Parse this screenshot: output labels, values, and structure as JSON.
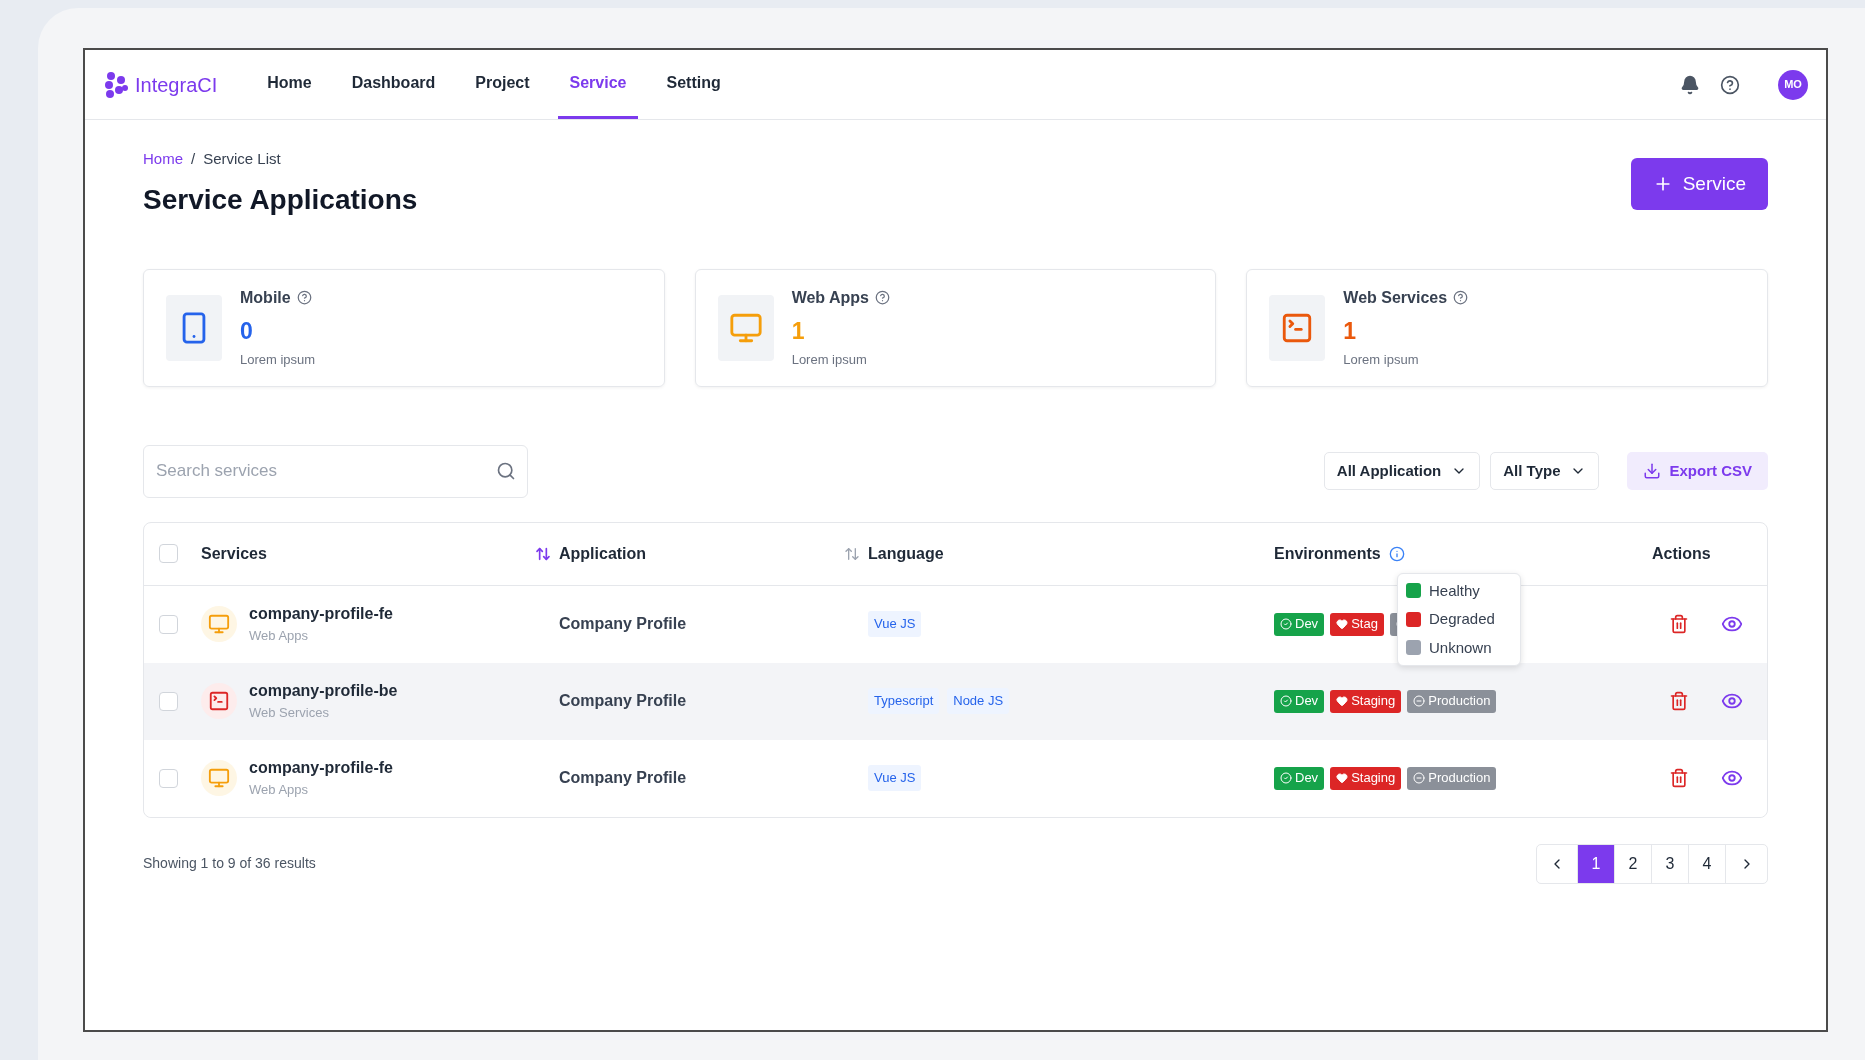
{
  "brand": {
    "name": "IntegraCI"
  },
  "nav": [
    {
      "label": "Home",
      "selected": false
    },
    {
      "label": "Dashboard",
      "selected": false
    },
    {
      "label": "Project",
      "selected": false
    },
    {
      "label": "Service",
      "selected": true
    },
    {
      "label": "Setting",
      "selected": false
    }
  ],
  "user": {
    "initials": "MO"
  },
  "breadcrumb": [
    {
      "label": "Home",
      "link": true
    },
    {
      "label": "Service List",
      "link": false
    }
  ],
  "breadcrumb_separator": "/",
  "page_title": "Service Applications",
  "add_button": {
    "label": "Service"
  },
  "cards": [
    {
      "kind": "mobile",
      "title": "Mobile",
      "value": "0",
      "caption": "Lorem ipsum"
    },
    {
      "kind": "web_app",
      "title": "Web Apps",
      "value": "1",
      "caption": "Lorem ipsum"
    },
    {
      "kind": "web_service",
      "title": "Web Services",
      "value": "1",
      "caption": "Lorem ipsum"
    }
  ],
  "search": {
    "placeholder": "Search services"
  },
  "filters": [
    {
      "label": "All Application"
    },
    {
      "label": "All Type"
    }
  ],
  "export_button": {
    "label": "Export CSV"
  },
  "table": {
    "select_all": {
      "checked": false
    },
    "columns": [
      {
        "label": "Services",
        "sortable": true,
        "sort_active": true
      },
      {
        "label": "Application",
        "sortable": true,
        "sort_active": false
      },
      {
        "label": "Language"
      },
      {
        "label": "Environments",
        "info": true
      },
      {
        "label": "Actions"
      }
    ],
    "legend": [
      {
        "label": "Healthy",
        "color": "#16a34a"
      },
      {
        "label": "Degraded",
        "color": "#dc2626"
      },
      {
        "label": "Unknown",
        "color": "#9ca3af"
      }
    ],
    "rows": [
      {
        "checked": false,
        "hovered": false,
        "kind": "web_app",
        "name": "company-profile-fe",
        "type": "Web Apps",
        "application": "Company Profile",
        "languages": [
          "Vue JS"
        ],
        "environments": [
          {
            "kind": "healthy",
            "label": "Dev"
          },
          {
            "kind": "degraded",
            "label": "Stag"
          },
          {
            "kind": "unknown"
          }
        ]
      },
      {
        "checked": false,
        "hovered": true,
        "kind": "web_service",
        "name": "company-profile-be",
        "type": "Web Services",
        "application": "Company Profile",
        "languages": [
          "Typescript",
          "Node JS"
        ],
        "environments": [
          {
            "kind": "healthy",
            "label": "Dev"
          },
          {
            "kind": "degraded",
            "label": "Staging"
          },
          {
            "kind": "unknown",
            "label": "Production"
          }
        ]
      },
      {
        "checked": false,
        "hovered": false,
        "kind": "web_app",
        "name": "company-profile-fe",
        "type": "Web Apps",
        "application": "Company Profile",
        "languages": [
          "Vue JS"
        ],
        "environments": [
          {
            "kind": "healthy",
            "label": "Dev"
          },
          {
            "kind": "degraded",
            "label": "Staging"
          },
          {
            "kind": "unknown",
            "label": "Production"
          }
        ]
      }
    ]
  },
  "results_text": "Showing 1 to 9 of 36 results",
  "pagination": [
    {
      "label": "1",
      "selected": true
    },
    {
      "label": "2",
      "selected": false
    },
    {
      "label": "3",
      "selected": false
    },
    {
      "label": "4",
      "selected": false
    }
  ]
}
